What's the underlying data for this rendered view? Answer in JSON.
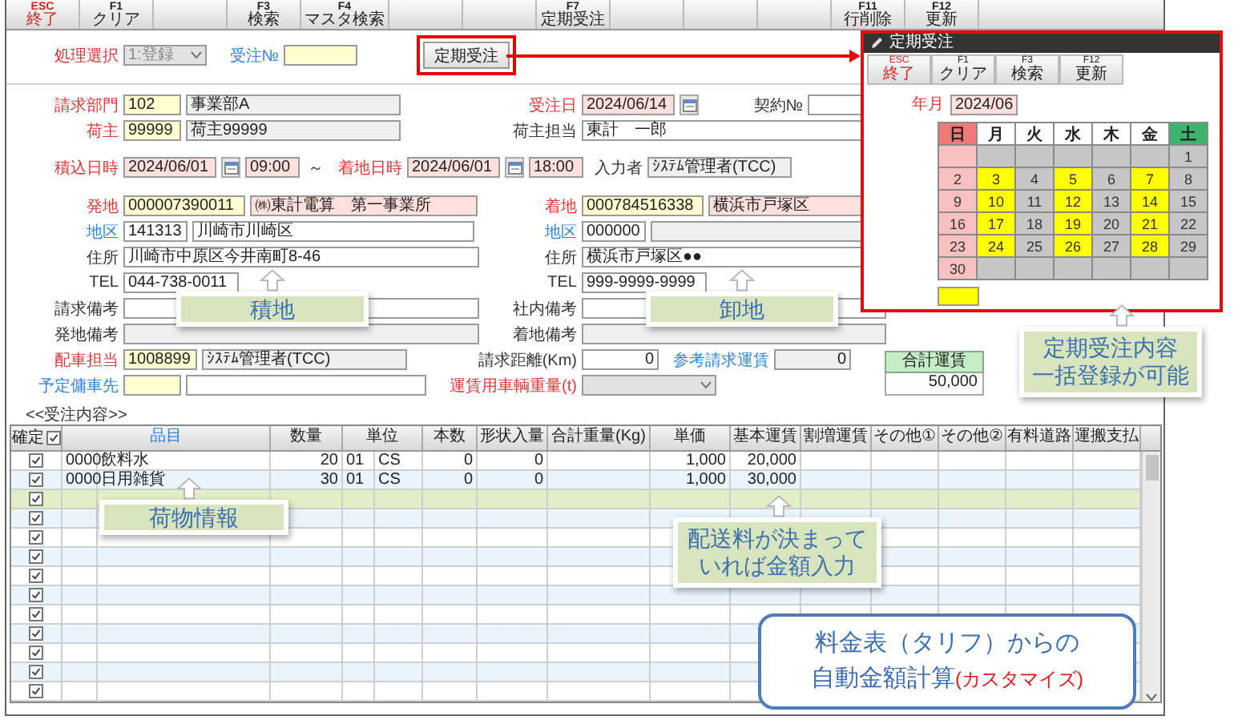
{
  "toolbar": [
    {
      "kind": "exit",
      "key": "ESC",
      "label": "終了"
    },
    {
      "kind": "key",
      "key": "F1",
      "label": "クリア"
    },
    {
      "kind": "blank"
    },
    {
      "kind": "key",
      "key": "F3",
      "label": "検索"
    },
    {
      "kind": "key",
      "key": "F4",
      "label": "マスタ検索"
    },
    {
      "kind": "blank"
    },
    {
      "kind": "blank"
    },
    {
      "kind": "key",
      "key": "F7",
      "label": "定期受注"
    },
    {
      "kind": "blank"
    },
    {
      "kind": "blank"
    },
    {
      "kind": "blank"
    },
    {
      "kind": "key",
      "key": "F11",
      "label": "行削除"
    },
    {
      "kind": "key",
      "key": "F12",
      "label": "更新"
    }
  ],
  "schedule_button": {
    "label": "定期受注",
    "highlighted": true
  },
  "form": {
    "process": {
      "label": "処理選択",
      "required": true,
      "link": false,
      "inputs": [
        {
          "kind": "select",
          "value": "1:登録",
          "disabled": true
        }
      ]
    },
    "order_no": {
      "label": "受注№",
      "required": false,
      "link": true,
      "inputs": [
        {
          "kind": "text",
          "color": "#ffffd2"
        }
      ]
    },
    "billing_dept": {
      "label": "請求部門",
      "required": true,
      "link": false,
      "inputs": [
        {
          "kind": "text",
          "value": "102",
          "color": "#ffffd2"
        },
        {
          "kind": "text",
          "value": "事業部A",
          "color": "#efefef"
        }
      ]
    },
    "order_date": {
      "label": "受注日",
      "required": true,
      "link": false,
      "inputs": [
        {
          "kind": "text",
          "value": "2024/06/14",
          "color": "#ffe0dc"
        },
        {
          "kind": "calendar"
        }
      ]
    },
    "contract_no": {
      "label": "契約№",
      "required": false,
      "link": false,
      "inputs": [
        {
          "kind": "text",
          "color": "#ffffff"
        }
      ]
    },
    "shipper": {
      "label": "荷主",
      "required": true,
      "link": false,
      "inputs": [
        {
          "kind": "text",
          "value": "99999",
          "color": "#ffffd2"
        },
        {
          "kind": "text",
          "value": "荷主99999",
          "color": "#efefef"
        }
      ]
    },
    "shipper_contact": {
      "label": "荷主担当",
      "required": false,
      "link": false,
      "inputs": [
        {
          "kind": "text",
          "value": "東計　一郎",
          "color": "#ffffff"
        }
      ]
    },
    "loading_time": {
      "label": "積込日時",
      "required": true,
      "link": false,
      "inputs": [
        {
          "kind": "text",
          "value": "2024/06/01",
          "color": "#ffe0dc"
        },
        {
          "kind": "calendar"
        },
        {
          "kind": "text",
          "value": "09:00",
          "color": "#ffe0dc"
        }
      ]
    },
    "range_separator": "～",
    "arrival_time": {
      "label": "着地日時",
      "required": true,
      "link": false,
      "inputs": [
        {
          "kind": "text",
          "value": "2024/06/01",
          "color": "#ffe0dc"
        },
        {
          "kind": "calendar"
        },
        {
          "kind": "text",
          "value": "18:00",
          "color": "#ffe0dc"
        }
      ]
    },
    "entered_by": {
      "label": "入力者",
      "required": false,
      "link": false,
      "inputs": [
        {
          "kind": "text",
          "value": "ｼｽﾃﾑ管理者(TCC)",
          "color": "#efefef"
        }
      ]
    },
    "origin": {
      "label": "発地",
      "required": true,
      "link": false,
      "inputs": [
        {
          "kind": "text",
          "value": "000007390011",
          "color": "#ffffd2"
        },
        {
          "kind": "text",
          "value": "㈱東計電算　第一事業所",
          "color": "#ffe0dc"
        }
      ]
    },
    "destination": {
      "label": "着地",
      "required": true,
      "link": false,
      "inputs": [
        {
          "kind": "text",
          "value": "000784516338",
          "color": "#ffffd2"
        },
        {
          "kind": "text",
          "value": "横浜市戸塚区",
          "color": "#ffe0dc"
        }
      ]
    },
    "origin_area": {
      "label": "地区",
      "required": false,
      "link": true,
      "inputs": [
        {
          "kind": "text",
          "value": "141313",
          "color": "#ffffff"
        },
        {
          "kind": "text",
          "value": "川崎市川崎区",
          "color": "#ffffff"
        }
      ]
    },
    "dest_area": {
      "label": "地区",
      "required": false,
      "link": true,
      "inputs": [
        {
          "kind": "text",
          "value": "000000",
          "color": "#ffffff"
        },
        {
          "kind": "text",
          "color": "#efefef"
        }
      ]
    },
    "origin_address": {
      "label": "住所",
      "required": false,
      "link": false,
      "inputs": [
        {
          "kind": "text",
          "value": "川崎市中原区今井南町8-46",
          "color": "#ffffff"
        }
      ]
    },
    "dest_address": {
      "label": "住所",
      "required": false,
      "link": false,
      "inputs": [
        {
          "kind": "text",
          "value": "横浜市戸塚区●●",
          "color": "#ffffff"
        }
      ]
    },
    "origin_tel": {
      "label": "TEL",
      "required": false,
      "link": false,
      "inputs": [
        {
          "kind": "text",
          "value": "044-738-0011",
          "color": "#ffffff"
        }
      ]
    },
    "dest_tel": {
      "label": "TEL",
      "required": false,
      "link": false,
      "inputs": [
        {
          "kind": "text",
          "value": "999-9999-9999",
          "color": "#ffffff"
        }
      ]
    },
    "billing_note": {
      "label": "請求備考",
      "required": false,
      "link": false,
      "inputs": [
        {
          "kind": "text",
          "color": "#ffffff"
        }
      ]
    },
    "internal_note": {
      "label": "社内備考",
      "required": false,
      "link": false,
      "inputs": [
        {
          "kind": "text",
          "color": "#ffffff"
        }
      ]
    },
    "origin_note": {
      "label": "発地備考",
      "required": false,
      "link": false,
      "inputs": [
        {
          "kind": "text",
          "color": "#efefef"
        }
      ]
    },
    "dest_note": {
      "label": "着地備考",
      "required": false,
      "link": false,
      "inputs": [
        {
          "kind": "text",
          "color": "#efefef"
        }
      ]
    },
    "dispatcher": {
      "label": "配車担当",
      "required": true,
      "link": false,
      "inputs": [
        {
          "kind": "text",
          "value": "1008899",
          "color": "#ffffd2"
        },
        {
          "kind": "text",
          "value": "ｼｽﾃﾑ管理者(TCC)",
          "color": "#efefef"
        }
      ]
    },
    "billing_distance": {
      "label": "請求距離(Km)",
      "required": false,
      "link": false,
      "inputs": [
        {
          "kind": "text",
          "value": "0",
          "color": "#ffffff"
        }
      ]
    },
    "ref_fare": {
      "label": "参考請求運賃",
      "required": false,
      "link": true,
      "inputs": [
        {
          "kind": "text",
          "value": "0",
          "color": "#efefef"
        }
      ]
    },
    "planned_carrier": {
      "label": "予定傭車先",
      "required": false,
      "link": true,
      "inputs": [
        {
          "kind": "text",
          "color": "#ffffd2"
        },
        {
          "kind": "text",
          "color": "#ffffff"
        }
      ]
    },
    "vehicle_weight": {
      "label": "運賃用車輌重量(t)",
      "required": true,
      "link": false,
      "inputs": [
        {
          "kind": "select",
          "disabled": true
        }
      ]
    }
  },
  "total_fare": {
    "label": "合計運賃",
    "value": "50,000"
  },
  "order_section_title": "<<受注内容>>",
  "table": {
    "confirm_all": {
      "label": "確定",
      "checked": true
    },
    "columns": [
      {
        "label": "品目",
        "link": true
      },
      {
        "label": "数量",
        "link": false
      },
      {
        "label": "単位",
        "link": false
      },
      {
        "label": "本数",
        "link": false
      },
      {
        "label": "形状入量",
        "link": false
      },
      {
        "label": "合計重量(Kg)",
        "link": false
      },
      {
        "label": "単価",
        "link": false
      },
      {
        "label": "基本運賃",
        "link": false
      },
      {
        "label": "割増運賃",
        "link": false
      },
      {
        "label": "その他①",
        "link": false
      },
      {
        "label": "その他②",
        "link": false
      },
      {
        "label": "有料道路",
        "link": false
      },
      {
        "label": "運搬支払",
        "link": false
      }
    ],
    "rows": [
      {
        "selected": false,
        "checked": true,
        "item_code": "0000",
        "item_name": "飲料水",
        "qty": "20",
        "unit_code": "01",
        "unit": "CS",
        "count": "0",
        "shape_qty": "0",
        "unit_price": "1,000",
        "base_fare": "20,000"
      },
      {
        "selected": false,
        "checked": true,
        "item_code": "0000",
        "item_name": "日用雑貨",
        "qty": "30",
        "unit_code": "01",
        "unit": "CS",
        "count": "0",
        "shape_qty": "0",
        "unit_price": "1,000",
        "base_fare": "30,000"
      },
      {
        "selected": true,
        "checked": true
      },
      {
        "selected": false,
        "checked": true
      },
      {
        "selected": false,
        "checked": true
      },
      {
        "selected": false,
        "checked": true
      },
      {
        "selected": false,
        "checked": true
      },
      {
        "selected": false,
        "checked": true
      },
      {
        "selected": false,
        "checked": true
      },
      {
        "selected": false,
        "checked": true
      },
      {
        "selected": false,
        "checked": true
      },
      {
        "selected": false,
        "checked": true
      },
      {
        "selected": false,
        "checked": true
      }
    ]
  },
  "popup": {
    "title": "定期受注",
    "toolbar": [
      {
        "kind": "exit",
        "key": "ESC",
        "label": "終了"
      },
      {
        "kind": "key",
        "key": "F1",
        "label": "クリア"
      },
      {
        "kind": "key",
        "key": "F3",
        "label": "検索"
      },
      {
        "kind": "key",
        "key": "F12",
        "label": "更新"
      }
    ],
    "month": {
      "label": "年月",
      "value": "2024/06"
    },
    "weekdays": [
      {
        "label": "日",
        "kind": "sunday"
      },
      {
        "label": "月",
        "kind": "weekday"
      },
      {
        "label": "火",
        "kind": "weekday"
      },
      {
        "label": "水",
        "kind": "weekday"
      },
      {
        "label": "木",
        "kind": "weekday"
      },
      {
        "label": "金",
        "kind": "weekday"
      },
      {
        "label": "土",
        "kind": "saturday"
      }
    ],
    "weeks": [
      [
        {
          "kind": "blank"
        },
        {
          "kind": "blank"
        },
        {
          "kind": "blank"
        },
        {
          "kind": "blank"
        },
        {
          "kind": "blank"
        },
        {
          "kind": "blank"
        },
        {
          "kind": "day",
          "day": "1",
          "selected": false
        }
      ],
      [
        {
          "kind": "day",
          "day": "2",
          "selected": false
        },
        {
          "kind": "day",
          "day": "3",
          "selected": true
        },
        {
          "kind": "day",
          "day": "4",
          "selected": false
        },
        {
          "kind": "day",
          "day": "5",
          "selected": true
        },
        {
          "kind": "day",
          "day": "6",
          "selected": false
        },
        {
          "kind": "day",
          "day": "7",
          "selected": true
        },
        {
          "kind": "day",
          "day": "8",
          "selected": false
        }
      ],
      [
        {
          "kind": "day",
          "day": "9",
          "selected": false
        },
        {
          "kind": "day",
          "day": "10",
          "selected": true
        },
        {
          "kind": "day",
          "day": "11",
          "selected": false
        },
        {
          "kind": "day",
          "day": "12",
          "selected": true
        },
        {
          "kind": "day",
          "day": "13",
          "selected": false
        },
        {
          "kind": "day",
          "day": "14",
          "selected": true
        },
        {
          "kind": "day",
          "day": "15",
          "selected": false
        }
      ],
      [
        {
          "kind": "day",
          "day": "16",
          "selected": false
        },
        {
          "kind": "day",
          "day": "17",
          "selected": true
        },
        {
          "kind": "day",
          "day": "18",
          "selected": false
        },
        {
          "kind": "day",
          "day": "19",
          "selected": true
        },
        {
          "kind": "day",
          "day": "20",
          "selected": false
        },
        {
          "kind": "day",
          "day": "21",
          "selected": true
        },
        {
          "kind": "day",
          "day": "22",
          "selected": false
        }
      ],
      [
        {
          "kind": "day",
          "day": "23",
          "selected": false
        },
        {
          "kind": "day",
          "day": "24",
          "selected": true
        },
        {
          "kind": "day",
          "day": "25",
          "selected": false
        },
        {
          "kind": "day",
          "day": "26",
          "selected": true
        },
        {
          "kind": "day",
          "day": "27",
          "selected": false
        },
        {
          "kind": "day",
          "day": "28",
          "selected": true
        },
        {
          "kind": "day",
          "day": "29",
          "selected": false
        }
      ],
      [
        {
          "kind": "day",
          "day": "30",
          "selected": false
        },
        {
          "kind": "blank"
        },
        {
          "kind": "blank"
        },
        {
          "kind": "blank"
        },
        {
          "kind": "blank"
        },
        {
          "kind": "blank"
        },
        {
          "kind": "blank"
        }
      ]
    ]
  },
  "callouts": [
    {
      "kind": "note",
      "lines": [
        "積地"
      ]
    },
    {
      "kind": "note",
      "lines": [
        "卸地"
      ]
    },
    {
      "kind": "note",
      "lines": [
        "荷物情報"
      ]
    },
    {
      "kind": "note",
      "lines": [
        "配送料が決まって",
        "いれば金額入力"
      ]
    },
    {
      "kind": "note",
      "lines": [
        "定期受注内容",
        "一括登録が可能"
      ]
    },
    {
      "kind": "bubble",
      "lines": [
        "料金表（タリフ）からの",
        "自動金額計算"
      ],
      "note": "(カスタマイズ)"
    }
  ]
}
